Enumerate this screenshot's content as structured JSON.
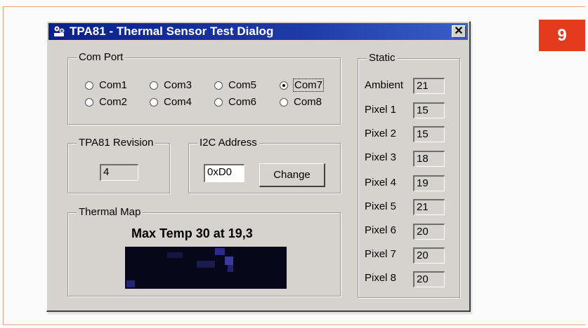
{
  "figure": {
    "number": "9"
  },
  "window": {
    "title": "TPA81 - Thermal Sensor Test Dialog",
    "close_symbol": "✕"
  },
  "com_port": {
    "label": "Com Port",
    "options": [
      "Com1",
      "Com2",
      "Com3",
      "Com4",
      "Com5",
      "Com6",
      "Com7",
      "Com8"
    ],
    "selected": "Com7"
  },
  "revision": {
    "label": "TPA81 Revision",
    "value": "4"
  },
  "i2c": {
    "label": "I2C Address",
    "value": "0xD0",
    "button_label": "Change"
  },
  "thermal_map": {
    "label": "Thermal Map",
    "max_temp_text": "Max Temp 30 at 19,3"
  },
  "static_panel": {
    "label": "Static",
    "readings": [
      {
        "label": "Ambient",
        "value": "21"
      },
      {
        "label": "Pixel 1",
        "value": "15"
      },
      {
        "label": "Pixel 2",
        "value": "15"
      },
      {
        "label": "Pixel 3",
        "value": "18"
      },
      {
        "label": "Pixel 4",
        "value": "19"
      },
      {
        "label": "Pixel 5",
        "value": "21"
      },
      {
        "label": "Pixel 6",
        "value": "20"
      },
      {
        "label": "Pixel 7",
        "value": "20"
      },
      {
        "label": "Pixel 8",
        "value": "20"
      }
    ]
  },
  "colors": {
    "badge": "#e43a1e",
    "titlebar": "#0a1f8c",
    "dialog": "#d6d3ce",
    "thermal_bg": "#07071a",
    "thermal_hot": "#3a3aa0"
  }
}
